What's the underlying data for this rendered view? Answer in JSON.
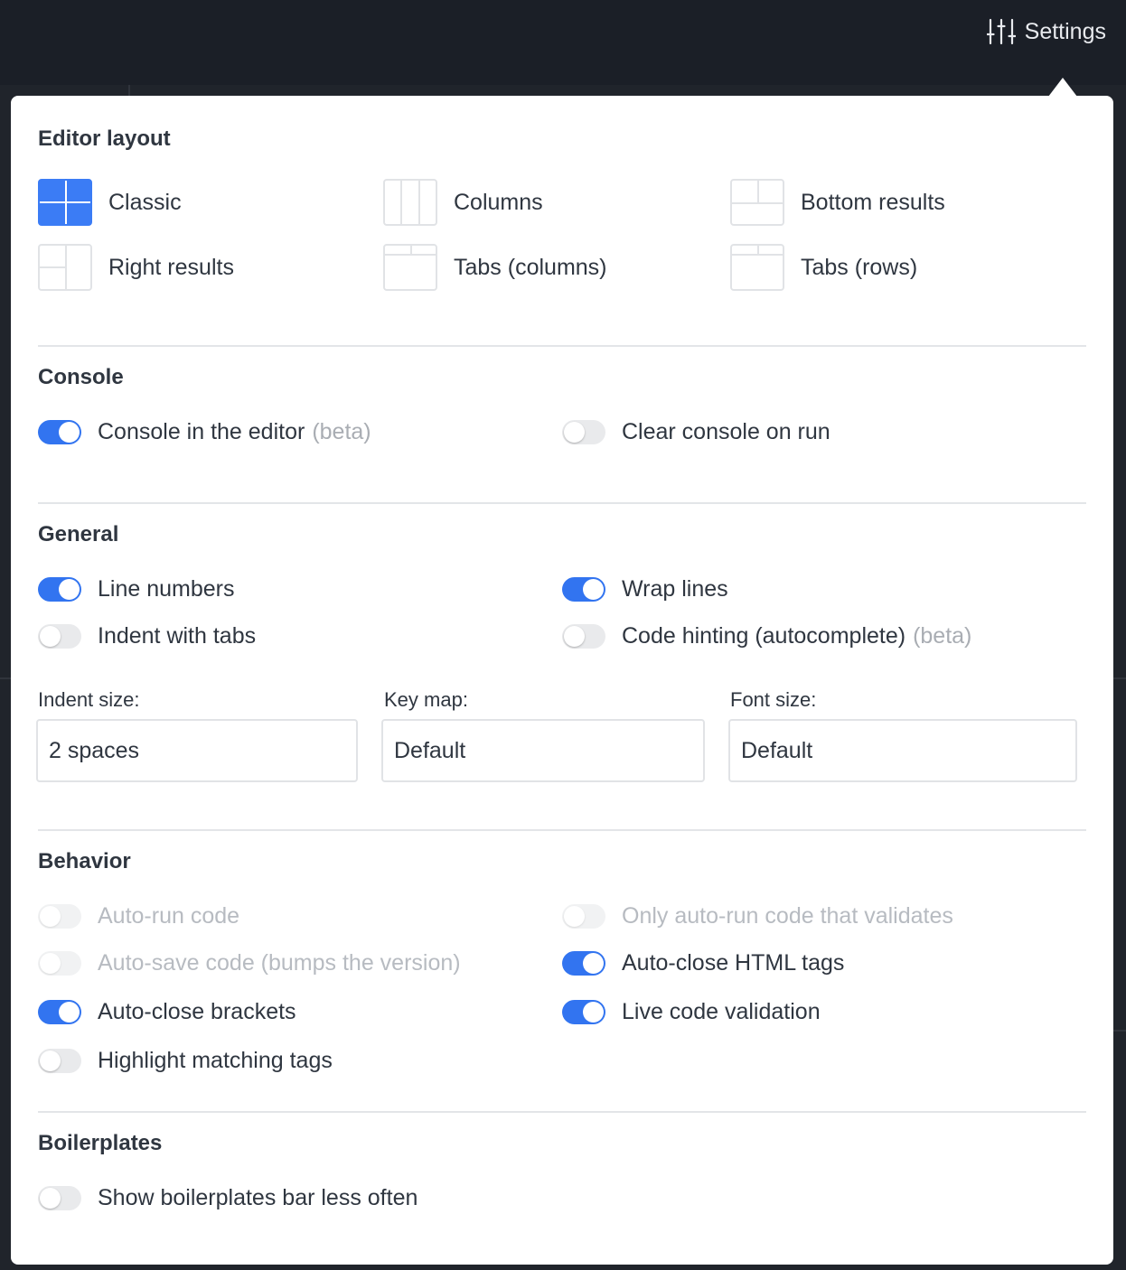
{
  "header": {
    "settings_label": "Settings",
    "settings_icon": "sliders-icon"
  },
  "editor_layout": {
    "title": "Editor layout",
    "options": [
      {
        "label": "Classic",
        "selected": true
      },
      {
        "label": "Columns",
        "selected": false
      },
      {
        "label": "Bottom results",
        "selected": false
      },
      {
        "label": "Right results",
        "selected": false
      },
      {
        "label": "Tabs (columns)",
        "selected": false
      },
      {
        "label": "Tabs (rows)",
        "selected": false
      }
    ]
  },
  "console": {
    "title": "Console",
    "console_in_editor": {
      "label": "Console in the editor",
      "note": "(beta)",
      "on": true
    },
    "clear_on_run": {
      "label": "Clear console on run",
      "on": false
    }
  },
  "general": {
    "title": "General",
    "line_numbers": {
      "label": "Line numbers",
      "on": true
    },
    "wrap_lines": {
      "label": "Wrap lines",
      "on": true
    },
    "indent_tabs": {
      "label": "Indent with tabs",
      "on": false
    },
    "code_hinting": {
      "label": "Code hinting (autocomplete)",
      "note": "(beta)",
      "on": false
    },
    "indent_size": {
      "label": "Indent size:",
      "value": "2 spaces"
    },
    "key_map": {
      "label": "Key map:",
      "value": "Default"
    },
    "font_size": {
      "label": "Font size:",
      "value": "Default"
    }
  },
  "behavior": {
    "title": "Behavior",
    "auto_run": {
      "label": "Auto-run code",
      "on": false,
      "disabled": true
    },
    "only_validates": {
      "label": "Only auto-run code that validates",
      "on": false,
      "disabled": true
    },
    "auto_save": {
      "label": "Auto-save code (bumps the version)",
      "on": false,
      "disabled": true
    },
    "auto_close_html": {
      "label": "Auto-close HTML tags",
      "on": true
    },
    "auto_close_brackets": {
      "label": "Auto-close brackets",
      "on": true
    },
    "live_validation": {
      "label": "Live code validation",
      "on": true
    },
    "highlight_tags": {
      "label": "Highlight matching tags",
      "on": false
    }
  },
  "boilerplates": {
    "title": "Boilerplates",
    "less_often": {
      "label": "Show boilerplates bar less often",
      "on": false
    }
  },
  "colors": {
    "accent": "#3274f0",
    "topbar": "#1b1f27",
    "panel": "#ffffff"
  }
}
